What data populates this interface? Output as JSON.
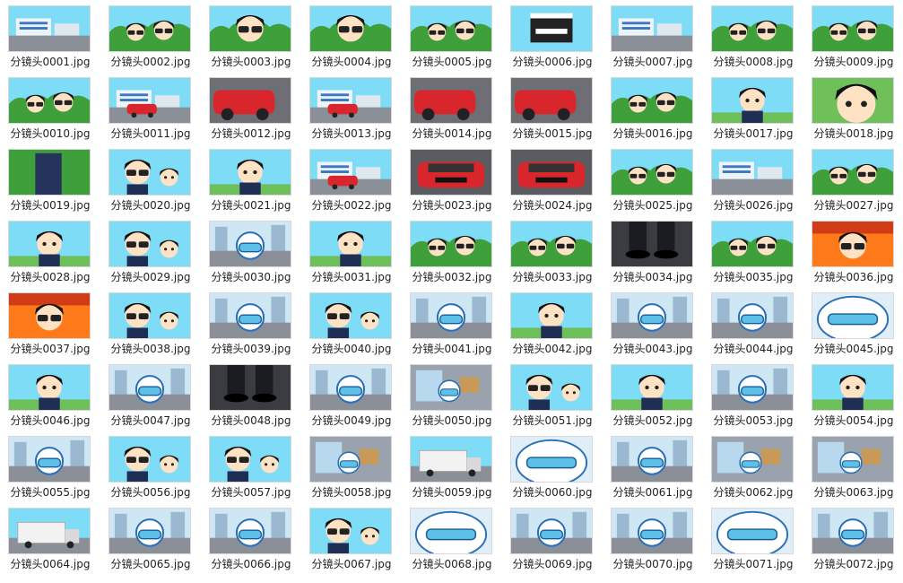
{
  "colors": {
    "sky": "#7fdcf6",
    "road": "#8b8f98",
    "bush": "#3f9f3a",
    "car": "#d9262c",
    "fire": "#ff7a1a",
    "white": "#f4f4f4"
  },
  "files": [
    {
      "name": "分镜头0001.jpg",
      "scene": "building"
    },
    {
      "name": "分镜头0002.jpg",
      "scene": "bush-two"
    },
    {
      "name": "分镜头0003.jpg",
      "scene": "bush-face"
    },
    {
      "name": "分镜头0004.jpg",
      "scene": "bush-face"
    },
    {
      "name": "分镜头0005.jpg",
      "scene": "bush-two"
    },
    {
      "name": "分镜头0006.jpg",
      "scene": "clapper"
    },
    {
      "name": "分镜头0007.jpg",
      "scene": "building"
    },
    {
      "name": "分镜头0008.jpg",
      "scene": "bush-two"
    },
    {
      "name": "分镜头0009.jpg",
      "scene": "bush-two"
    },
    {
      "name": "分镜头0010.jpg",
      "scene": "bush-two"
    },
    {
      "name": "分镜头0011.jpg",
      "scene": "car-street"
    },
    {
      "name": "分镜头0012.jpg",
      "scene": "car-close"
    },
    {
      "name": "分镜头0013.jpg",
      "scene": "car-street"
    },
    {
      "name": "分镜头0014.jpg",
      "scene": "car-close"
    },
    {
      "name": "分镜头0015.jpg",
      "scene": "car-close"
    },
    {
      "name": "分镜头0016.jpg",
      "scene": "bush-two"
    },
    {
      "name": "分镜头0017.jpg",
      "scene": "sky-face"
    },
    {
      "name": "分镜头0018.jpg",
      "scene": "face-close"
    },
    {
      "name": "分镜头0019.jpg",
      "scene": "bush-suit"
    },
    {
      "name": "分镜头0020.jpg",
      "scene": "sky-two"
    },
    {
      "name": "分镜头0021.jpg",
      "scene": "sky-face"
    },
    {
      "name": "分镜头0022.jpg",
      "scene": "car-street"
    },
    {
      "name": "分镜头0023.jpg",
      "scene": "car-front"
    },
    {
      "name": "分镜头0024.jpg",
      "scene": "car-front"
    },
    {
      "name": "分镜头0025.jpg",
      "scene": "bush-two"
    },
    {
      "name": "分镜头0026.jpg",
      "scene": "building"
    },
    {
      "name": "分镜头0027.jpg",
      "scene": "bush-two"
    },
    {
      "name": "分镜头0028.jpg",
      "scene": "sky-face"
    },
    {
      "name": "分镜头0029.jpg",
      "scene": "sky-two"
    },
    {
      "name": "分镜头0030.jpg",
      "scene": "city-white"
    },
    {
      "name": "分镜头0031.jpg",
      "scene": "sky-face"
    },
    {
      "name": "分镜头0032.jpg",
      "scene": "bush-two"
    },
    {
      "name": "分镜头0033.jpg",
      "scene": "bush-two"
    },
    {
      "name": "分镜头0034.jpg",
      "scene": "dark-feet"
    },
    {
      "name": "分镜头0035.jpg",
      "scene": "bush-two"
    },
    {
      "name": "分镜头0036.jpg",
      "scene": "fire-face"
    },
    {
      "name": "分镜头0037.jpg",
      "scene": "fire-face"
    },
    {
      "name": "分镜头0038.jpg",
      "scene": "sky-two"
    },
    {
      "name": "分镜头0039.jpg",
      "scene": "city-white"
    },
    {
      "name": "分镜头0040.jpg",
      "scene": "sky-two"
    },
    {
      "name": "分镜头0041.jpg",
      "scene": "city-white"
    },
    {
      "name": "分镜头0042.jpg",
      "scene": "sky-face"
    },
    {
      "name": "分镜头0043.jpg",
      "scene": "city-white"
    },
    {
      "name": "分镜头0044.jpg",
      "scene": "city-white"
    },
    {
      "name": "分镜头0045.jpg",
      "scene": "helmet-close"
    },
    {
      "name": "分镜头0046.jpg",
      "scene": "sky-face"
    },
    {
      "name": "分镜头0047.jpg",
      "scene": "city-white"
    },
    {
      "name": "分镜头0048.jpg",
      "scene": "dark-feet"
    },
    {
      "name": "分镜头0049.jpg",
      "scene": "city-white"
    },
    {
      "name": "分镜头0050.jpg",
      "scene": "warehouse"
    },
    {
      "name": "分镜头0051.jpg",
      "scene": "sky-two"
    },
    {
      "name": "分镜头0052.jpg",
      "scene": "sky-face"
    },
    {
      "name": "分镜头0053.jpg",
      "scene": "city-white"
    },
    {
      "name": "分镜头0054.jpg",
      "scene": "sky-face"
    },
    {
      "name": "分镜头0055.jpg",
      "scene": "city-white"
    },
    {
      "name": "分镜头0056.jpg",
      "scene": "sky-two"
    },
    {
      "name": "分镜头0057.jpg",
      "scene": "sky-two"
    },
    {
      "name": "分镜头0058.jpg",
      "scene": "warehouse"
    },
    {
      "name": "分镜头0059.jpg",
      "scene": "truck"
    },
    {
      "name": "分镜头0060.jpg",
      "scene": "helmet-close"
    },
    {
      "name": "分镜头0061.jpg",
      "scene": "city-white"
    },
    {
      "name": "分镜头0062.jpg",
      "scene": "warehouse"
    },
    {
      "name": "分镜头0063.jpg",
      "scene": "warehouse"
    },
    {
      "name": "分镜头0064.jpg",
      "scene": "truck"
    },
    {
      "name": "分镜头0065.jpg",
      "scene": "city-white"
    },
    {
      "name": "分镜头0066.jpg",
      "scene": "city-white"
    },
    {
      "name": "分镜头0067.jpg",
      "scene": "sky-two"
    },
    {
      "name": "分镜头0068.jpg",
      "scene": "helmet-close"
    },
    {
      "name": "分镜头0069.jpg",
      "scene": "city-white"
    },
    {
      "name": "分镜头0070.jpg",
      "scene": "city-white"
    },
    {
      "name": "分镜头0071.jpg",
      "scene": "helmet-close"
    },
    {
      "name": "分镜头0072.jpg",
      "scene": "city-white"
    }
  ]
}
